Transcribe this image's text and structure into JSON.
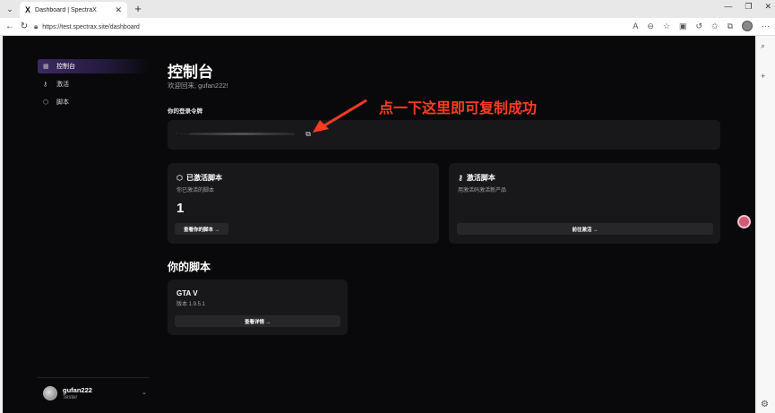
{
  "browser": {
    "tab_title": "Dashboard | SpectraX",
    "tab_favicon": "X",
    "url": "https://test.spectrax.site/dashboard"
  },
  "sidebar": {
    "items": [
      {
        "label": "控制台",
        "icon": "dashboard-icon",
        "active": true
      },
      {
        "label": "激活",
        "icon": "key-icon",
        "active": false
      },
      {
        "label": "脚本",
        "icon": "package-icon",
        "active": false
      }
    ],
    "user": {
      "name": "gufan222",
      "role": "Tester"
    }
  },
  "main": {
    "title": "控制台",
    "welcome": "欢迎回来, gufan222!",
    "token_label": "你的登录令牌",
    "token_value": "·  ...................................  ·",
    "annotation": "点一下这里即可复制成功",
    "cards": {
      "active_scripts": {
        "title": "已激活脚本",
        "subtitle": "你已激活的脚本",
        "count": "1",
        "button": "查看你的脚本 →"
      },
      "activate": {
        "title": "激活脚本",
        "subtitle": "用激活码激活新产品",
        "button": "前往激活 →"
      }
    },
    "scripts_section_title": "你的脚本",
    "scripts": [
      {
        "name": "GTA V",
        "version": "版本 1.9.5.1",
        "button": "查看详情 →"
      }
    ]
  },
  "colors": {
    "background": "#09090b",
    "card": "#18181b",
    "accent": "#3b2a63",
    "annotation": "#ff3b22"
  }
}
